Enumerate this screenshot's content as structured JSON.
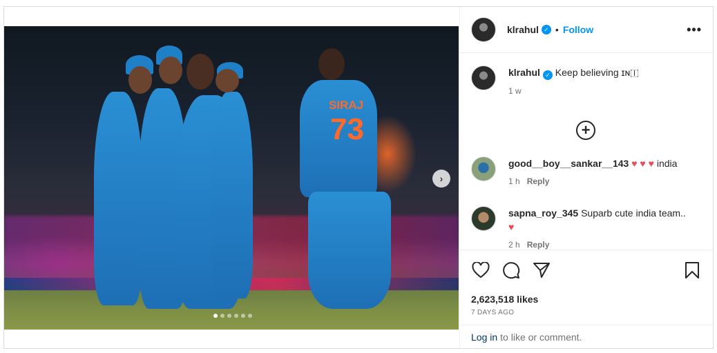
{
  "post": {
    "username": "klrahul",
    "follow_label": "Follow",
    "separator": "•",
    "more_label": "•••"
  },
  "caption": {
    "username": "klrahul",
    "text": "Keep believing ɪɴ🇮",
    "time": "1 w"
  },
  "load_more_label": "+",
  "comments": [
    {
      "username": "good__boy__sankar__143",
      "text_after_hearts": "india",
      "hearts": "♥ ♥ ♥",
      "time": "1 h",
      "reply_label": "Reply"
    },
    {
      "username": "sapna_roy_345",
      "text": "Suparb cute india team..",
      "heart": "♥",
      "time": "2 h",
      "reply_label": "Reply"
    }
  ],
  "photo": {
    "jersey_name": "SIRAJ",
    "jersey_number": "73"
  },
  "carousel": {
    "next_label": "›",
    "total": 6,
    "active": 1
  },
  "likes": "2,623,518 likes",
  "date": "7 DAYS AGO",
  "login": {
    "link": "Log in",
    "rest": "to like or comment."
  },
  "colors": {
    "accent": "#0095f6",
    "heart": "#ed4956",
    "link_dark": "#00376b"
  },
  "icons": [
    "heart-icon",
    "comment-icon",
    "share-icon",
    "bookmark-icon",
    "verified-icon",
    "more-icon",
    "plus-circle-icon",
    "chevron-right-icon"
  ]
}
